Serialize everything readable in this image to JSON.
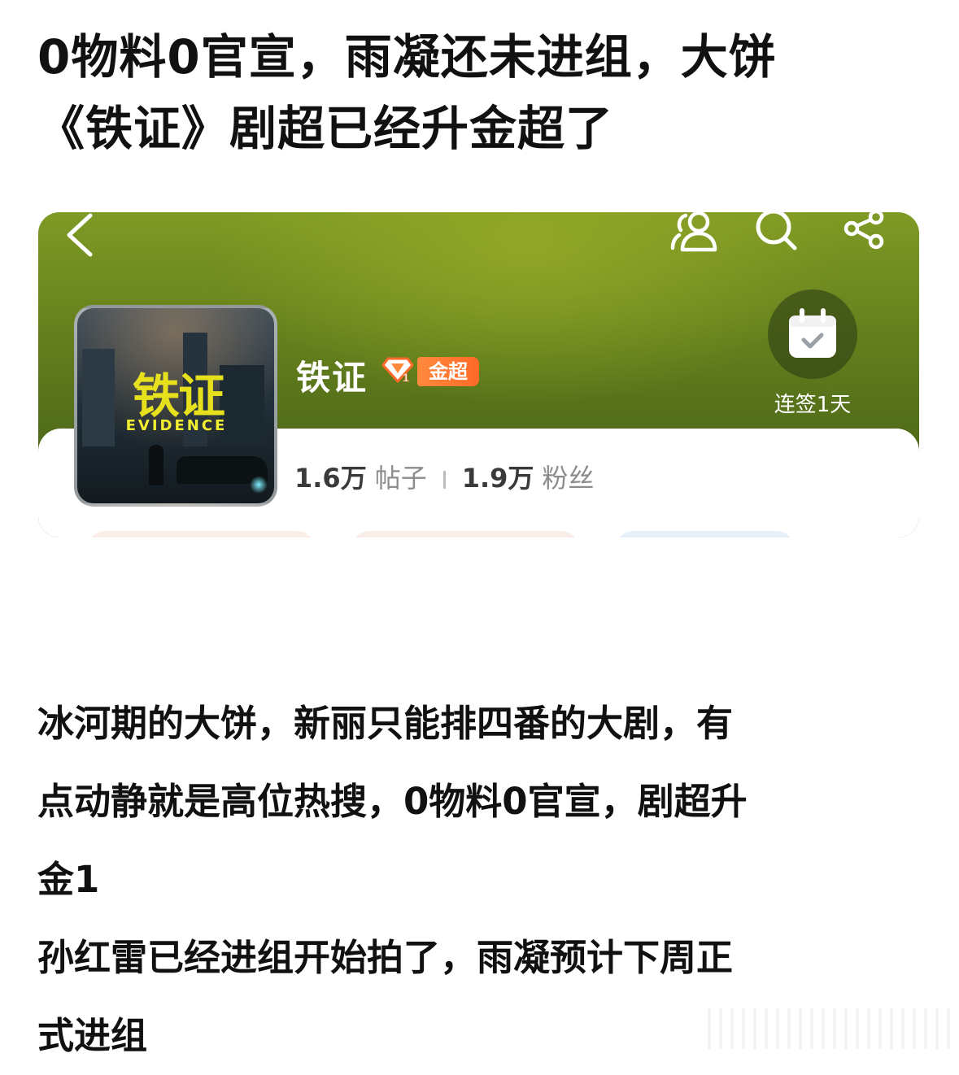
{
  "post": {
    "title_line1": "0物料0官宣，雨凝还未进组，大饼",
    "title_line2": "《铁证》剧超已经升金超了",
    "body": {
      "line1": "冰河期的大饼，新丽只能排四番的大剧，有",
      "line2": "点动静就是高位热搜，0物料0官宣，剧超升",
      "line3": "金1",
      "line4": "孙红雷已经进组开始拍了，雨凝预计下周正",
      "line5": "式进组"
    }
  },
  "supertopic": {
    "header_icons": [
      "back-icon",
      "members-icon",
      "search-icon",
      "share-icon"
    ],
    "cover": {
      "title_zh": "铁证",
      "title_en": "EVIDENCE"
    },
    "name": "铁证",
    "level_badge": {
      "icon": "gem-icon",
      "level": "1",
      "label": "金超"
    },
    "checkin": {
      "icon": "calendar-check-icon",
      "label": "连签1天"
    },
    "stats": {
      "posts_count": "1.6万",
      "posts_label": "帖子",
      "fans_count": "1.9万",
      "fans_label": "粉丝"
    }
  },
  "colors": {
    "header_green": "#6f8c1f",
    "badge_orange": "#ff7a32",
    "title_text": "#111111",
    "stats_label": "#8c8c8c"
  }
}
